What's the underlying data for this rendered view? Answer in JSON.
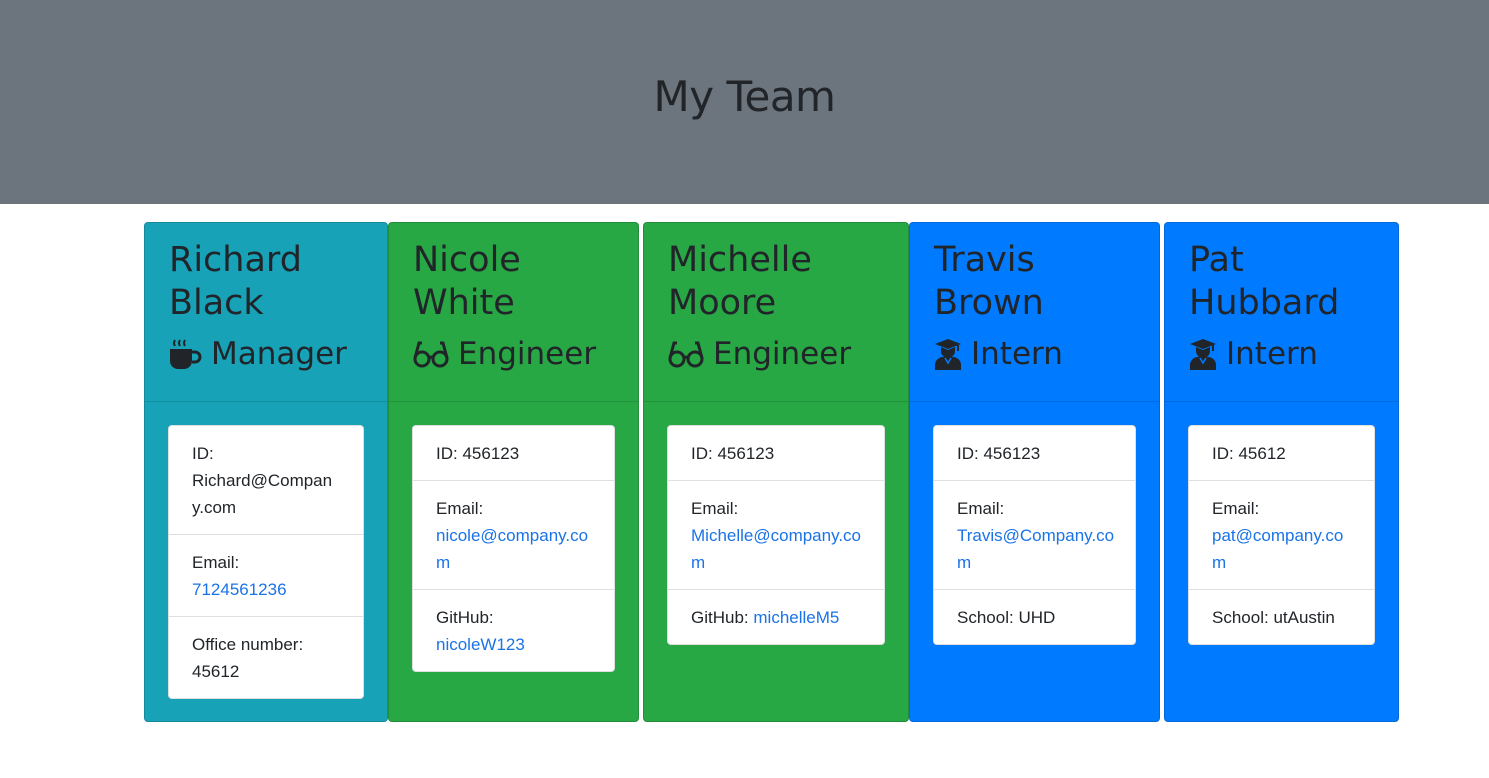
{
  "header": {
    "title": "My Team"
  },
  "cards": [
    {
      "name": "Richard\nBlack",
      "role": "Manager",
      "icon": "coffee-mug-icon",
      "id_label": "ID:",
      "id_value": "Richard@Company.com",
      "email_label": "Email:",
      "email_value": "7124561236",
      "extra_label": "Office number:",
      "extra_value": "45612"
    },
    {
      "name": "Nicole\nWhite",
      "role": "Engineer",
      "icon": "glasses-icon",
      "id_label": "ID:",
      "id_value": "456123",
      "email_label": "Email:",
      "email_value": "nicole@company.com",
      "extra_label": "GitHub:",
      "extra_value": "nicoleW123"
    },
    {
      "name": "Michelle\nMoore",
      "role": "Engineer",
      "icon": "glasses-icon",
      "id_label": "ID:",
      "id_value": "456123",
      "email_label": "Email:",
      "email_value": "Michelle@company.com",
      "extra_label": "GitHub:",
      "extra_value": "michelleM5"
    },
    {
      "name": "Travis\nBrown",
      "role": "Intern",
      "icon": "graduate-icon",
      "id_label": "ID:",
      "id_value": "456123",
      "email_label": "Email:",
      "email_value": "Travis@Company.com",
      "extra_label": "School:",
      "extra_value": "UHD"
    },
    {
      "name": "Pat\nHubbard",
      "role": "Intern",
      "icon": "graduate-icon",
      "id_label": "ID:",
      "id_value": "45612",
      "email_label": "Email:",
      "email_value": "pat@company.com",
      "extra_label": "School:",
      "extra_value": "utAustin"
    }
  ],
  "colors": {
    "header_bg": "#6c757d",
    "manager": "#17a2b8",
    "engineer": "#28a745",
    "intern": "#007bff",
    "link": "#1a73e8"
  }
}
